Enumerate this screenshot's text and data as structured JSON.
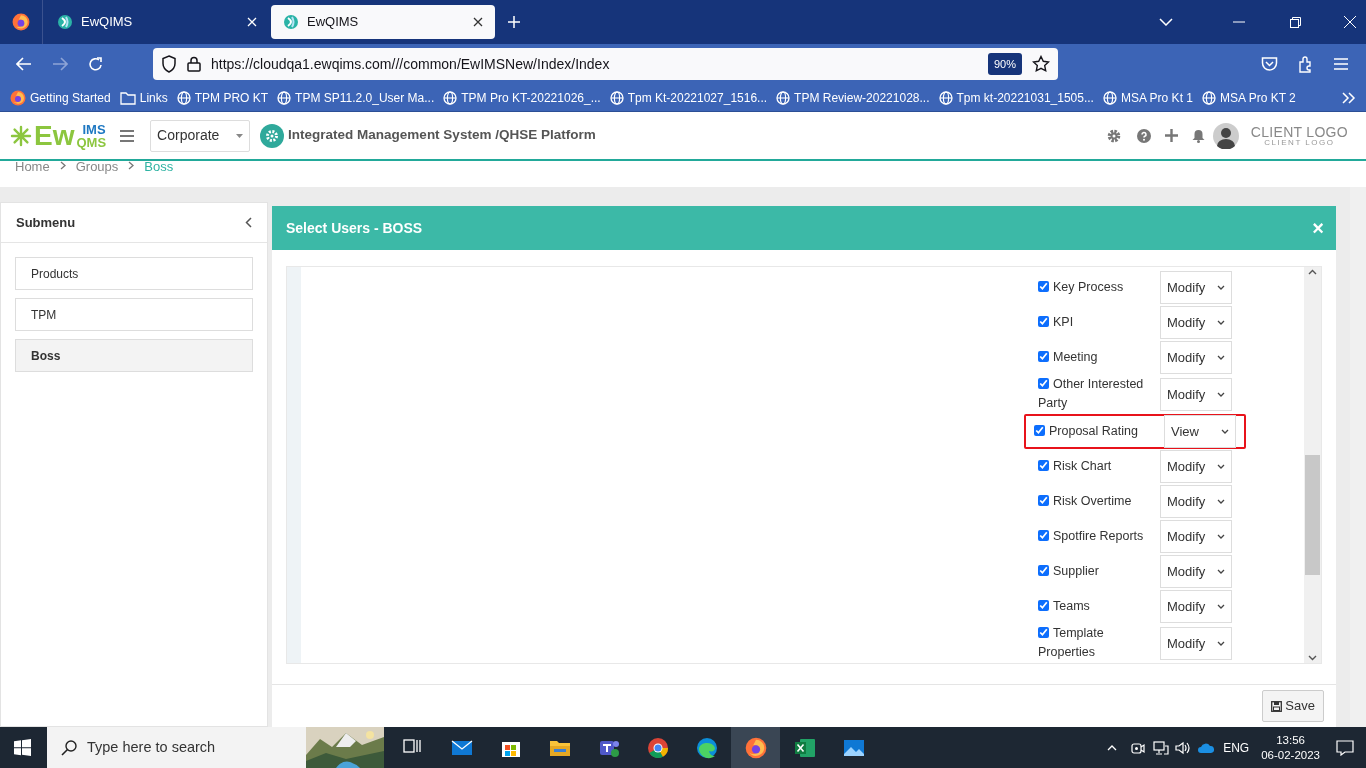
{
  "browser": {
    "tabs": [
      {
        "title": "EwQIMS",
        "selected": false
      },
      {
        "title": "EwQIMS",
        "selected": true
      }
    ],
    "url": "https://cloudqa1.ewqims.com///common/EwIMSNew/Index/Index",
    "zoom": "90%",
    "bookmarks": [
      {
        "label": "Getting Started",
        "kind": "firefox"
      },
      {
        "label": "Links",
        "kind": "folder"
      },
      {
        "label": "TPM PRO KT",
        "kind": "web"
      },
      {
        "label": "TPM SP11.2.0_User Ma...",
        "kind": "web"
      },
      {
        "label": "TPM Pro KT-20221026_...",
        "kind": "web"
      },
      {
        "label": "Tpm Kt-20221027_1516...",
        "kind": "web"
      },
      {
        "label": "TPM Review-20221028...",
        "kind": "web"
      },
      {
        "label": "Tpm kt-20221031_1505...",
        "kind": "web"
      },
      {
        "label": "MSA Pro Kt 1",
        "kind": "web"
      },
      {
        "label": "MSA Pro KT 2",
        "kind": "web"
      }
    ]
  },
  "app": {
    "logo": {
      "main": "Ew",
      "top": "IMS",
      "bottom": "QMS"
    },
    "organization": "Corporate",
    "title": "Integrated Management System /QHSE Platform",
    "client_logo": "CLIENT LOGO",
    "client_logo_sub": "CLIENT LOGO"
  },
  "breadcrumb": [
    {
      "label": "Home",
      "selected": false
    },
    {
      "label": "Groups",
      "selected": false
    },
    {
      "label": "Boss",
      "selected": true
    }
  ],
  "submenu": {
    "title": "Submenu",
    "items": [
      {
        "label": "Products",
        "selected": false
      },
      {
        "label": "TPM",
        "selected": false
      },
      {
        "label": "Boss",
        "selected": true
      }
    ]
  },
  "modal": {
    "title": "Select Users - BOSS",
    "close": "×",
    "save": "Save",
    "permissions": [
      {
        "label": "Key Process",
        "checked": true,
        "access": "Modify",
        "highlighted": false
      },
      {
        "label": "KPI",
        "checked": true,
        "access": "Modify",
        "highlighted": false
      },
      {
        "label": "Meeting",
        "checked": true,
        "access": "Modify",
        "highlighted": false
      },
      {
        "label": "Other Interested Party",
        "checked": true,
        "access": "Modify",
        "highlighted": false
      },
      {
        "label": "Proposal Rating",
        "checked": true,
        "access": "View",
        "highlighted": true
      },
      {
        "label": "Risk Chart",
        "checked": true,
        "access": "Modify",
        "highlighted": false
      },
      {
        "label": "Risk Overtime",
        "checked": true,
        "access": "Modify",
        "highlighted": false
      },
      {
        "label": "Spotfire Reports",
        "checked": true,
        "access": "Modify",
        "highlighted": false
      },
      {
        "label": "Supplier",
        "checked": true,
        "access": "Modify",
        "highlighted": false
      },
      {
        "label": "Teams",
        "checked": true,
        "access": "Modify",
        "highlighted": false
      },
      {
        "label": "Template Properties",
        "checked": true,
        "access": "Modify",
        "highlighted": false
      }
    ]
  },
  "taskbar": {
    "search_placeholder": "Type here to search",
    "language": "ENG",
    "time": "13:56",
    "date": "06-02-2023"
  }
}
